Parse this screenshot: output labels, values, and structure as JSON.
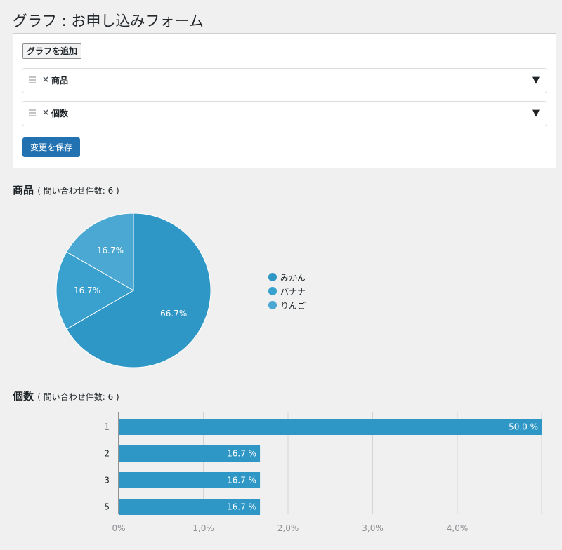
{
  "page": {
    "title": "グラフ : お申し込みフォーム"
  },
  "panel": {
    "add_button": "グラフを追加",
    "fields": [
      {
        "remove": "×",
        "label": "商品",
        "caret": "▼"
      },
      {
        "remove": "×",
        "label": "個数",
        "caret": "▼"
      }
    ],
    "save_button": "変更を保存"
  },
  "sections": [
    {
      "title": "商品",
      "count_text": "( 問い合わせ件数: 6 )"
    },
    {
      "title": "個数",
      "count_text": "( 問い合わせ件数: 6 )"
    }
  ],
  "colors": {
    "slice_1": "#2f97c6",
    "slice_2": "#3aa0ce",
    "slice_3": "#4aa8d2",
    "bar": "#2f97c6",
    "grid": "#d4d4d4"
  },
  "chart_data": [
    {
      "type": "pie",
      "slices": [
        {
          "label": "みかん",
          "value": 66.7,
          "text": "66.7%"
        },
        {
          "label": "バナナ",
          "value": 16.7,
          "text": "16.7%"
        },
        {
          "label": "りんご",
          "value": 16.7,
          "text": "16.7%"
        }
      ],
      "legend": "right"
    },
    {
      "type": "bar",
      "orientation": "horizontal",
      "categories": [
        "1",
        "2",
        "3",
        "5"
      ],
      "values": [
        50.0,
        16.7,
        16.7,
        16.7
      ],
      "value_labels": [
        "50.0 %",
        "16.7 %",
        "16.7 %",
        "16.7 %"
      ],
      "xticks": [
        "0%",
        "1,0%",
        "2,0%",
        "3,0%",
        "4,0%"
      ],
      "grid": true
    }
  ]
}
